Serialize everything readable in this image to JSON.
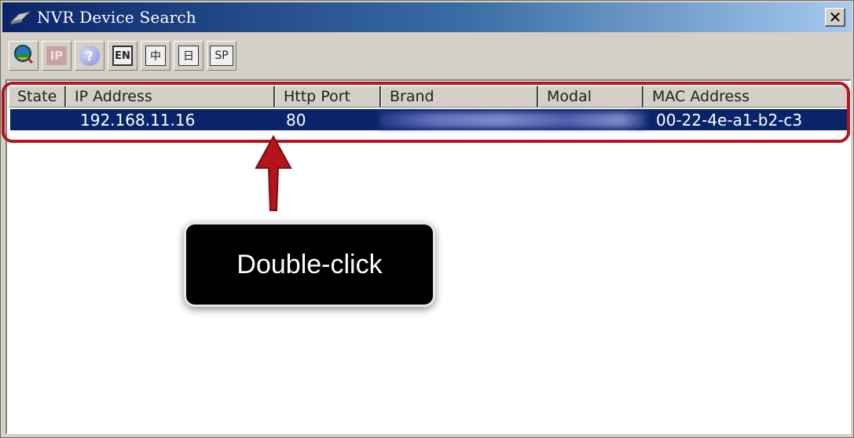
{
  "window": {
    "title": "NVR Device Search",
    "close_label": "✕"
  },
  "toolbar": {
    "buttons": [
      {
        "name": "search-refresh",
        "label": ""
      },
      {
        "name": "ip",
        "label": "IP"
      },
      {
        "name": "help",
        "label": "?"
      },
      {
        "name": "lang-en",
        "label": "EN"
      },
      {
        "name": "lang-zh",
        "label": "中"
      },
      {
        "name": "lang-jp",
        "label": "日"
      },
      {
        "name": "lang-sp",
        "label": "SP"
      }
    ]
  },
  "table": {
    "columns": [
      "State",
      "IP Address",
      "Http Port",
      "Brand",
      "Modal",
      "MAC Address"
    ],
    "rows": [
      {
        "state": "",
        "ip": "192.168.11.16",
        "port": "80",
        "brand": "",
        "modal": "",
        "mac": "00-22-4e-a1-b2-c3"
      }
    ]
  },
  "annotation": {
    "callout_text": "Double-click",
    "highlight_color": "#b3151b"
  },
  "colors": {
    "title_bar_start": "#0a246a",
    "title_bar_end": "#a6caf0",
    "selected_row": "#0a246a"
  }
}
